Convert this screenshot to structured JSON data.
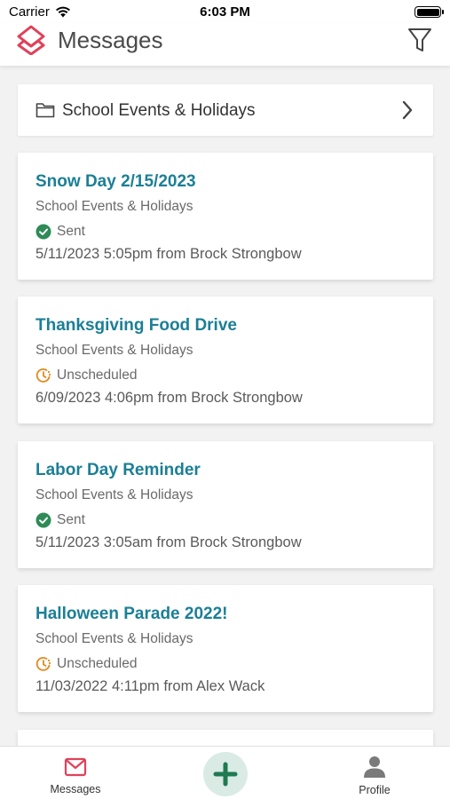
{
  "status_bar": {
    "carrier": "Carrier",
    "time": "6:03 PM"
  },
  "header": {
    "title": "Messages",
    "logo_icon": "app-logo-icon",
    "filter_icon": "filter-icon"
  },
  "folder": {
    "label": "School Events & Holidays",
    "icon": "folder-icon"
  },
  "messages": [
    {
      "title": "Snow Day 2/15/2023",
      "category": "School Events & Holidays",
      "status": "Sent",
      "meta": "5/11/2023 5:05pm from Brock Strongbow"
    },
    {
      "title": "Thanksgiving Food Drive",
      "category": "School Events & Holidays",
      "status": "Unscheduled",
      "meta": "6/09/2023 4:06pm from Brock Strongbow"
    },
    {
      "title": "Labor Day Reminder",
      "category": "School Events & Holidays",
      "status": "Sent",
      "meta": "5/11/2023 3:05am from Brock Strongbow"
    },
    {
      "title": "Halloween Parade 2022!",
      "category": "School Events & Holidays",
      "status": "Unscheduled",
      "meta": "11/03/2022 4:11pm from Alex Wack"
    }
  ],
  "tabs": {
    "messages_label": "Messages",
    "profile_label": "Profile"
  },
  "colors": {
    "accent": "#1b7f96",
    "sent": "#2e8b57",
    "unscheduled": "#e08a1e",
    "brand": "#e0415a"
  }
}
